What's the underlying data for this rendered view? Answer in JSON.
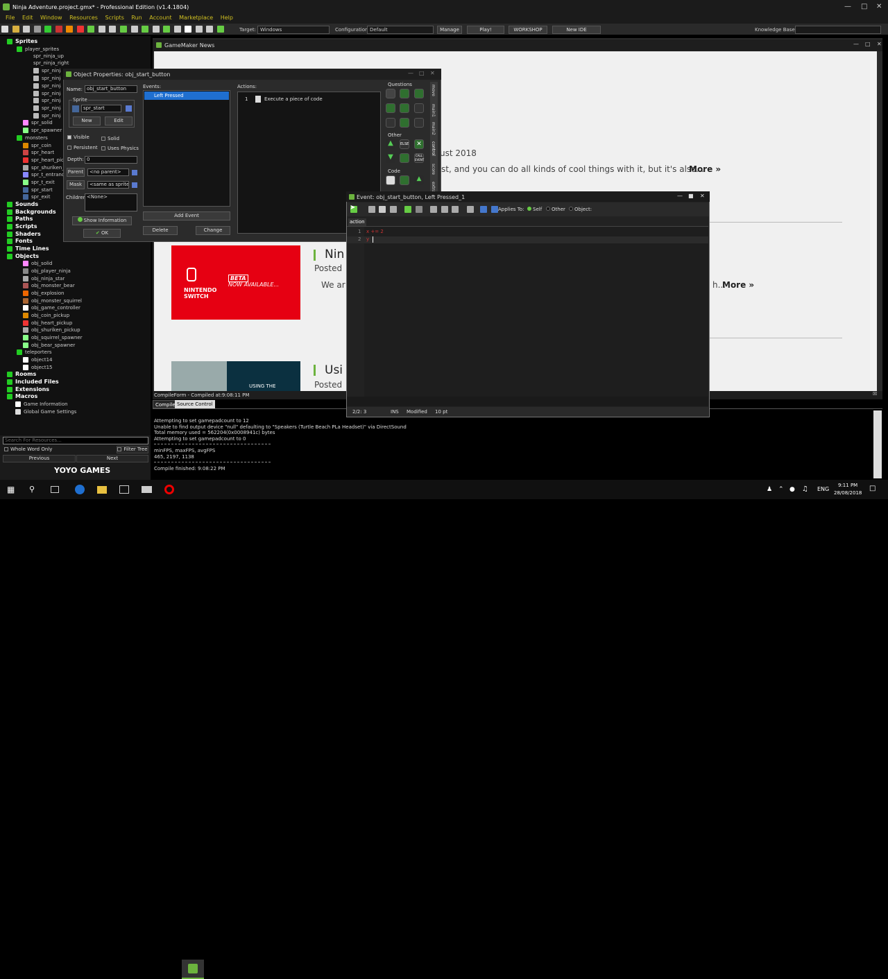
{
  "window": {
    "title": "Ninja Adventure.project.gmx* - Professional Edition (v1.4.1804)"
  },
  "menu": [
    "File",
    "Edit",
    "Window",
    "Resources",
    "Scripts",
    "Run",
    "Account",
    "Marketplace",
    "Help"
  ],
  "toolbar": {
    "target_label": "Target:",
    "target_value": "Windows",
    "config_label": "Configuration:",
    "config_value": "Default",
    "manage": "Manage",
    "play": "Play!",
    "workshop": "WORKSHOP",
    "newide": "New IDE",
    "kb_label": "Knowledge Base:"
  },
  "tree": {
    "sprites": "Sprites",
    "player_sprites": "player_sprites",
    "player_items": [
      "spr_ninja_up",
      "spr_ninja_right",
      "spr_ninja",
      "spr_ninja",
      "spr_ninja",
      "spr_ninja",
      "spr_ninja",
      "spr_ninja",
      "spr_ninja"
    ],
    "sprites_rest": [
      "spr_solid",
      "spr_spawner",
      "monsters",
      "spr_coin",
      "spr_heart",
      "spr_heart_pic",
      "spr_shuriken_",
      "spr_t_entranc",
      "spr_t_exit",
      "spr_start",
      "spr_exit"
    ],
    "groups1": [
      "Sounds",
      "Backgrounds",
      "Paths",
      "Scripts",
      "Shaders",
      "Fonts",
      "Time Lines",
      "Objects"
    ],
    "objects": [
      "obj_solid",
      "obj_player_ninja",
      "obj_ninja_star",
      "obj_monster_bear",
      "obj_explosion",
      "obj_monster_squirrel",
      "obj_game_controller",
      "obj_coin_pickup",
      "obj_heart_pickup",
      "obj_shuriken_pickup",
      "obj_squirrel_spawner",
      "obj_bear_spawner",
      "teleporters",
      "object14",
      "object15"
    ],
    "groups2": [
      "Rooms",
      "Included Files",
      "Extensions",
      "Macros",
      "Game Information",
      "Global Game Settings"
    ],
    "search_placeholder": "Search For Resources...",
    "whole_word": "Whole Word Only",
    "filter_tree": "Filter Tree",
    "previous": "Previous",
    "next": "Next",
    "logo": "YOYO GAMES"
  },
  "news": {
    "tab": "GameMaker News",
    "line1": "ust 2018",
    "line2": "st, and you can do all kinds of cool things with it, but it's also...",
    "more1": "More »",
    "h2": "Nin",
    "posted2": "Posted",
    "we_are": "We ar",
    "trail2": "h...",
    "more2": "More »",
    "switch_title": "NINTENDO SWITCH",
    "beta": "BETA",
    "now": "NOW AVAILABLE...",
    "h3": "Usi",
    "posted3": "Posted",
    "using_the": "USING THE"
  },
  "compile": {
    "title": "CompileForm - Compiled at:9:08:11 PM",
    "tab1": "Compile",
    "tab2": "Source Control",
    "lines": [
      "Attempting to set gamepadcount to 12",
      "Unable to find output device \"null\" defaulting to \"Speakers (Turtle Beach PLa Headset)\" via DirectSound",
      "Total memory used = 562204(0x0008941c) bytes",
      "Attempting to set gamepadcount to 0"
    ],
    "fps_label": "minFPS, maxFPS, avgFPS",
    "fps_values": "465, 2197, 1138",
    "finished": "Compile finished: 9:08:22 PM"
  },
  "objprops": {
    "title": "Object Properties: obj_start_button",
    "name_label": "Name:",
    "name_value": "obj_start_button",
    "sprite_label": "Sprite",
    "sprite_value": "spr_start",
    "new": "New",
    "edit": "Edit",
    "visible": "Visible",
    "solid": "Solid",
    "persistent": "Persistent",
    "uses_physics": "Uses Physics",
    "depth_label": "Depth:",
    "depth_value": "0",
    "parent": "Parent",
    "parent_value": "<no parent>",
    "mask": "Mask",
    "mask_value": "<same as sprite>",
    "children_label": "Children:",
    "children_value": "<None>",
    "show_info": "Show Information",
    "ok": "OK",
    "events_label": "Events:",
    "event_selected": "Left Pressed",
    "add_event": "Add Event",
    "delete": "Delete",
    "change": "Change",
    "actions_label": "Actions:",
    "action_num": "1",
    "action_text": "Execute a piece of code",
    "questions": "Questions",
    "other": "Other",
    "code": "Code",
    "tabs": [
      "move",
      "main1",
      "main2",
      "control",
      "score",
      "extra"
    ],
    "else": "ELSE",
    "call_event": "CALL EVENT"
  },
  "codeeditor": {
    "title": "Event: obj_start_button, Left Pressed_1",
    "applies_to": "Applies To:",
    "self": "Self",
    "other": "Other",
    "object": "Object:",
    "tab": "action",
    "lines": [
      {
        "num": "1",
        "text": "x += 2"
      },
      {
        "num": "2",
        "text": "y"
      }
    ],
    "status_pos": "2/2: 3",
    "status_ins": "INS",
    "status_modified": "Modified",
    "status_font": "10 pt"
  },
  "taskbar": {
    "lang": "ENG",
    "time": "9:11 PM",
    "date": "28/08/2018"
  }
}
